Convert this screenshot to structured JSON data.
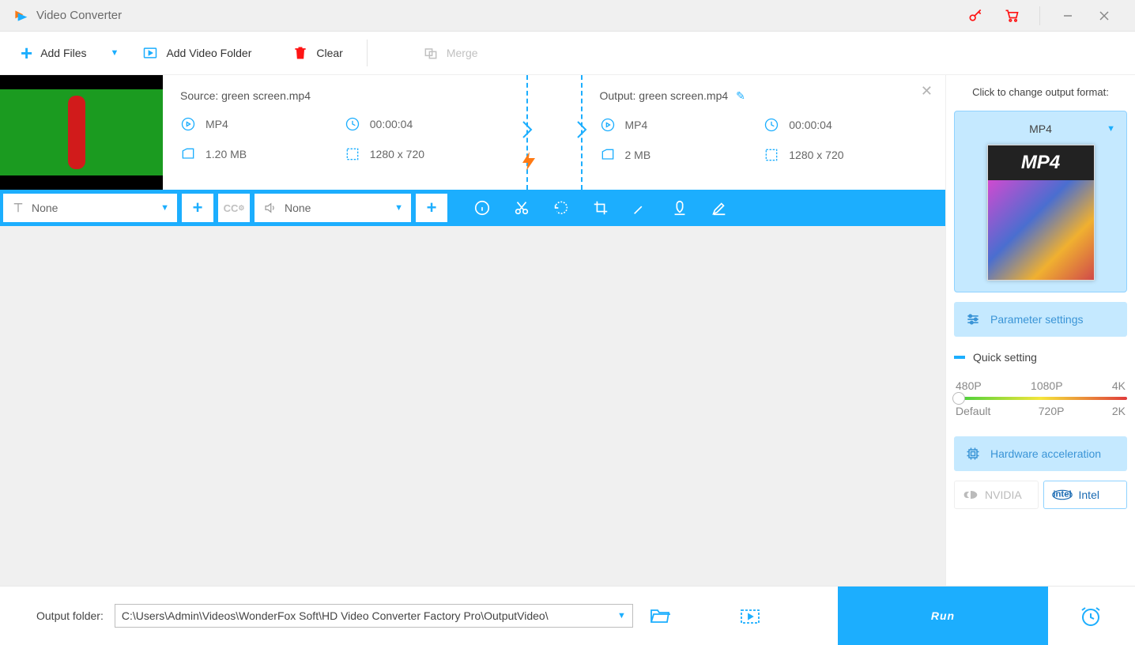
{
  "app": {
    "title": "Video Converter"
  },
  "toolbar": {
    "add_files": "Add Files",
    "add_folder": "Add Video Folder",
    "clear": "Clear",
    "merge": "Merge"
  },
  "file": {
    "source": {
      "label": "Source: green screen.mp4",
      "format": "MP4",
      "duration": "00:00:04",
      "size": "1.20 MB",
      "dims": "1280 x 720"
    },
    "output": {
      "label": "Output: green screen.mp4",
      "format": "MP4",
      "duration": "00:00:04",
      "size": "2 MB",
      "dims": "1280 x 720"
    }
  },
  "mediabar": {
    "subtitle": "None",
    "audio": "None"
  },
  "sidebar": {
    "title": "Click to change output format:",
    "format": "MP4",
    "param_settings": "Parameter settings",
    "quick_setting": "Quick setting",
    "slider": {
      "top": [
        "480P",
        "1080P",
        "4K"
      ],
      "bottom": [
        "Default",
        "720P",
        "2K"
      ]
    },
    "hw_accel": "Hardware acceleration",
    "nvidia": "NVIDIA",
    "intel": "Intel"
  },
  "footer": {
    "label": "Output folder:",
    "path": "C:\\Users\\Admin\\Videos\\WonderFox Soft\\HD Video Converter Factory Pro\\OutputVideo\\",
    "run": "Run"
  }
}
